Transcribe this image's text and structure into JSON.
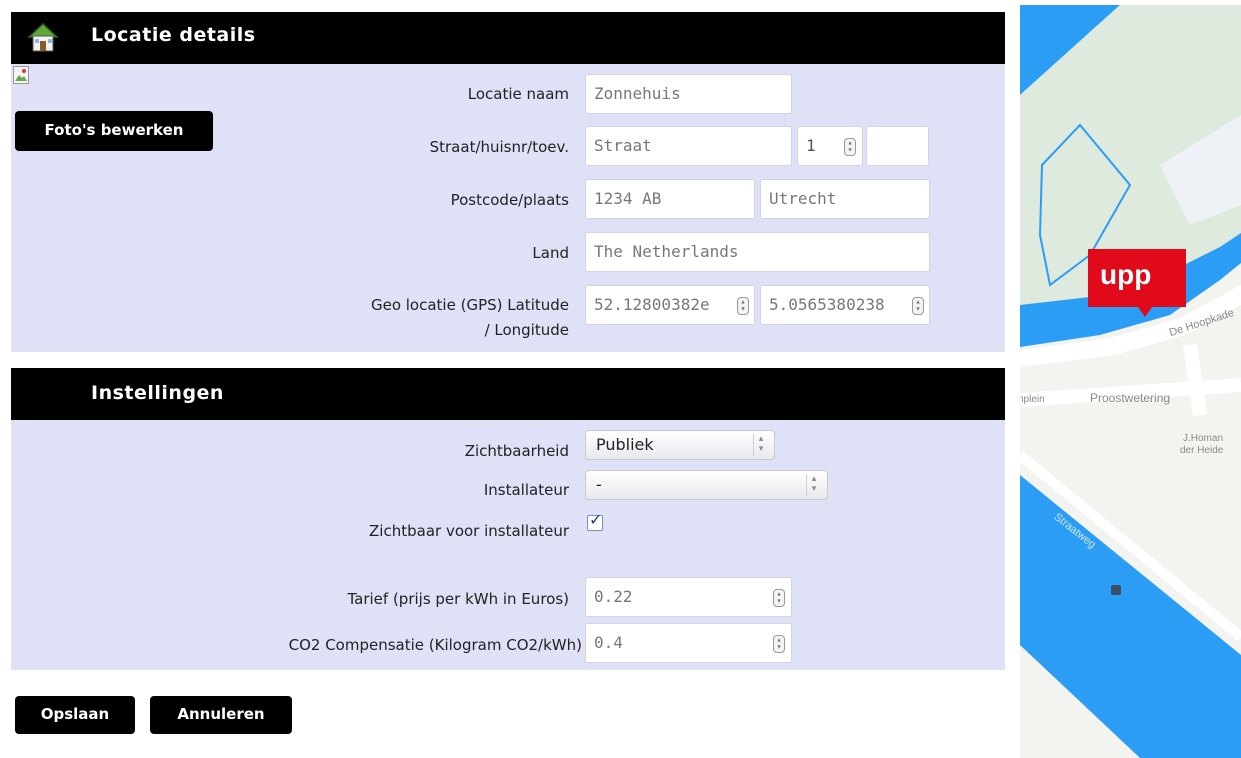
{
  "location": {
    "title": "Locatie details",
    "photo_button": "Foto's bewerken",
    "name_label": "Locatie naam",
    "name_value": "Zonnehuis",
    "street_label": "Straat/huisnr/toev.",
    "street_placeholder": "Straat",
    "house_number": "1",
    "addition": "",
    "postal_label": "Postcode/plaats",
    "postal_placeholder": "1234 AB",
    "city_placeholder": "Utrecht",
    "country_label": "Land",
    "country_value": "The Netherlands",
    "geo_label_line1": "Geo locatie (GPS) Latitude",
    "geo_label_line2": "/ Longitude",
    "latitude": "52.12800382е",
    "longitude": "5.0565380238"
  },
  "settings": {
    "title": "Instellingen",
    "visibility_label": "Zichtbaarheid",
    "visibility_value": "Publiek",
    "installer_label": "Installateur",
    "installer_value": "-",
    "visible_installer_label": "Zichtbaar voor installateur",
    "visible_installer_checked": true,
    "tariff_label": "Tarief (prijs per kWh in Euros)",
    "tariff_value": "0.22",
    "co2_label": "CO2 Compensatie (Kilogram CO2/kWh)",
    "co2_value": "0.4"
  },
  "actions": {
    "save": "Opslaan",
    "cancel": "Annuleren"
  },
  "map": {
    "marker_text": "upp",
    "streets": {
      "hoopkade": "De Hoopkade",
      "proostwetering": "Proostwetering",
      "plein": "nplein",
      "homan_line1": "J.Homan",
      "homan_line2": "der Heide",
      "straatweg": "Straatweg"
    },
    "colors": {
      "water": "#2b9df4",
      "park": "#dfeadf",
      "road": "#ffffff",
      "marker": "#e10a1b"
    }
  },
  "icons": {
    "header_icon": "house-icon",
    "broken_image": "broken-image-icon"
  }
}
